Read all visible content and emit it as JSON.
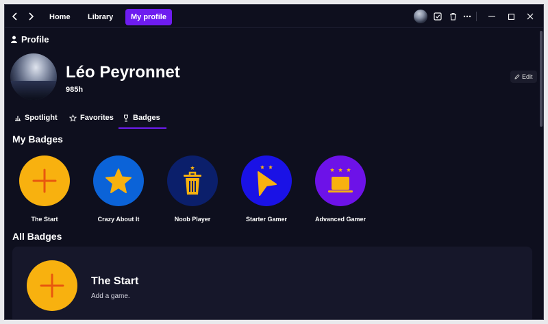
{
  "titlebar": {
    "nav": [
      {
        "label": "Home"
      },
      {
        "label": "Library"
      },
      {
        "label": "My profile"
      }
    ]
  },
  "profile": {
    "section_label": "Profile",
    "name": "Léo Peyronnet",
    "hours": "985h",
    "edit_label": "Edit",
    "tabs": [
      {
        "label": "Spotlight",
        "icon": "chart-icon"
      },
      {
        "label": "Favorites",
        "icon": "star-outline-icon"
      },
      {
        "label": "Badges",
        "icon": "trophy-icon"
      }
    ]
  },
  "my_badges": {
    "title": "My Badges",
    "items": [
      {
        "label": "The Start",
        "color": "#f8b10f",
        "icon": "plus-icon"
      },
      {
        "label": "Crazy About It",
        "color": "#0b63d8",
        "icon": "star-icon"
      },
      {
        "label": "Noob Player",
        "color": "#0b1f6b",
        "icon": "trash-icon"
      },
      {
        "label": "Starter Gamer",
        "color": "#1a12e6",
        "icon": "cursor-icon"
      },
      {
        "label": "Advanced Gamer",
        "color": "#6d12e8",
        "icon": "laptop-icon"
      }
    ]
  },
  "all_badges": {
    "title": "All Badges",
    "items": [
      {
        "title": "The Start",
        "description": "Add a game."
      }
    ]
  },
  "colors": {
    "accent": "#6e1cf0",
    "badge_fg": "#f8b10f",
    "badge_plus": "#e8570e",
    "background": "#0e0f1e"
  }
}
